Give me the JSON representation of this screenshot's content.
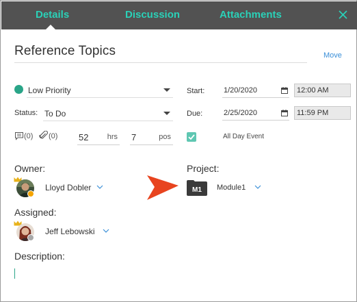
{
  "tabs": {
    "details": "Details",
    "discussion": "Discussion",
    "attachments": "Attachments"
  },
  "task": {
    "title": "Reference Topics",
    "move_label": "Move"
  },
  "priority": {
    "value": "Low Priority",
    "color": "#2aa588"
  },
  "status": {
    "label": "Status:",
    "value": "To Do"
  },
  "start": {
    "label": "Start:",
    "date": "1/20/2020",
    "time": "12:00 AM"
  },
  "due": {
    "label": "Due:",
    "date": "2/25/2020",
    "time": "11:59 PM"
  },
  "counts": {
    "comments": "(0)",
    "attachments": "(0)"
  },
  "effort": {
    "hours": "52",
    "hours_unit": "hrs",
    "points": "7",
    "points_unit": "pos"
  },
  "all_day": {
    "label": "All Day Event",
    "checked": true
  },
  "owner": {
    "label": "Owner:",
    "name": "Lloyd Dobler"
  },
  "assigned": {
    "label": "Assigned:",
    "name": "Jeff Lebowski"
  },
  "project": {
    "label": "Project:",
    "badge": "M1",
    "name": "Module1"
  },
  "description": {
    "label": "Description:",
    "value": ""
  },
  "colors": {
    "accent": "#2ad1b8",
    "header_bg": "#525252",
    "link": "#3a8fd8",
    "arrow": "#e8441f"
  }
}
